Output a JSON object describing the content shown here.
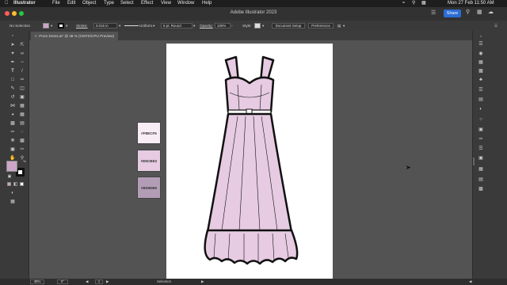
{
  "menubar": {
    "app": "Illustrator",
    "items": [
      "File",
      "Edit",
      "Object",
      "Type",
      "Select",
      "Effect",
      "View",
      "Window",
      "Help"
    ],
    "clock": "Mon 27 Feb  11:50 AM"
  },
  "window": {
    "title": "Adobe Illustrator 2023",
    "share_label": "Share"
  },
  "control_bar": {
    "selection": "No Selection",
    "stroke_label": "Stroke:",
    "stroke_value": "0.016 in",
    "profile": "Uniform",
    "brush": "5 pt. Round",
    "opacity_label": "Opacity:",
    "opacity_value": "100%",
    "style_label": "Style:",
    "document_setup": "Document Setup",
    "preferences": "Preferences"
  },
  "document_tab": {
    "label": "Prom Dress.ai* @ 48 % (CMYK/CPU Preview)"
  },
  "swatches": [
    {
      "hex": "#F8ECF5",
      "label": "#F8ECF5"
    },
    {
      "hex": "#E6CBE2",
      "label": "#E6CBE2"
    },
    {
      "hex": "#B39DB6",
      "label": "#B39DB6"
    }
  ],
  "status_bar": {
    "zoom": "48%",
    "rotation": "0°",
    "artboard": "1",
    "tool": "Selection"
  },
  "colors": {
    "dress_fill": "#E6CBE2",
    "dress_shadow": "#D9B8D5",
    "outline": "#111111",
    "fill_swatch": "#CBA6C6"
  }
}
